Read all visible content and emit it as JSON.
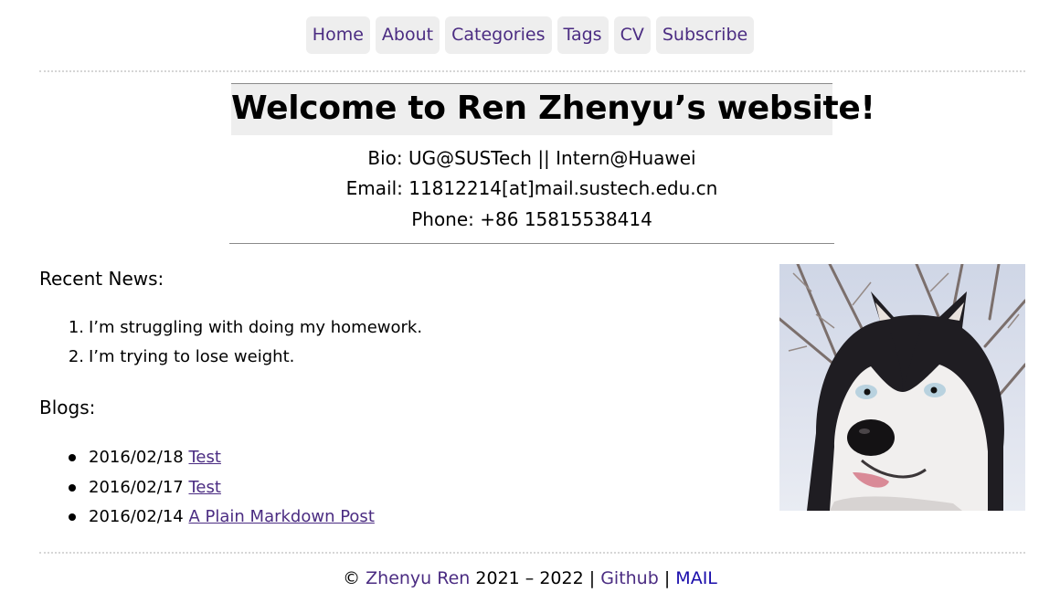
{
  "nav": {
    "items": [
      {
        "label": "Home"
      },
      {
        "label": "About"
      },
      {
        "label": "Categories"
      },
      {
        "label": "Tags"
      },
      {
        "label": "CV"
      },
      {
        "label": "Subscribe"
      }
    ]
  },
  "header": {
    "title": "Welcome to Ren Zhenyu’s website!",
    "bio": "Bio: UG@SUSTech || Intern@Huawei",
    "email": "Email: 11812214[at]mail.sustech.edu.cn",
    "phone": "Phone: +86 15815538414"
  },
  "news": {
    "heading": "Recent News:",
    "items": [
      {
        "marker": "1.",
        "text": "I’m struggling with doing my homework."
      },
      {
        "marker": "2.",
        "text": "I’m trying to lose weight."
      }
    ]
  },
  "blogs": {
    "heading": "Blogs:",
    "items": [
      {
        "date": "2016/02/18",
        "title": "Test"
      },
      {
        "date": "2016/02/17",
        "title": "Test"
      },
      {
        "date": "2016/02/14",
        "title": "A Plain Markdown Post"
      }
    ]
  },
  "footer": {
    "copyright": "©",
    "author": "Zhenyu Ren",
    "years": "2021 – 2022",
    "separator": "|",
    "github": "Github",
    "mail": "MAIL"
  },
  "colors": {
    "link": "#4b2c82",
    "mail_link": "#1a0dab",
    "nav_bg": "#eeeeee"
  }
}
